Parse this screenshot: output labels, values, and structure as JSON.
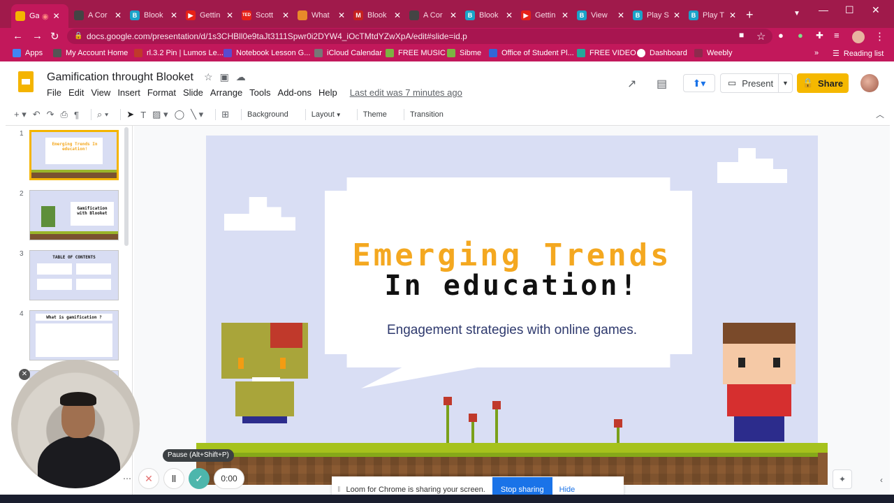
{
  "browser": {
    "tabs": [
      {
        "title": "Ga",
        "color": "#f4b400",
        "active": true
      },
      {
        "title": "A Cor",
        "color": "#444444"
      },
      {
        "title": "Blook",
        "color": "#1aa3c9"
      },
      {
        "title": "Gettin",
        "color": "#e62117"
      },
      {
        "title": "Scott",
        "color": "#e62117"
      },
      {
        "title": "What",
        "color": "#e88a2a"
      },
      {
        "title": "Blook",
        "color": "#c5221f"
      },
      {
        "title": "A Cor",
        "color": "#444444"
      },
      {
        "title": "Blook",
        "color": "#1aa3c9"
      },
      {
        "title": "Gettin",
        "color": "#e62117"
      },
      {
        "title": "View",
        "color": "#1aa3c9"
      },
      {
        "title": "Play S",
        "color": "#1aa3c9"
      },
      {
        "title": "Play T",
        "color": "#1aa3c9"
      }
    ],
    "url": "docs.google.com/presentation/d/1s3CHBll0e9taJt3111Spwr0i2DYW4_iOcTMtdYZwXpA/edit#slide=id.p",
    "bookmarks": [
      {
        "label": "Apps",
        "color": "#4285f4"
      },
      {
        "label": "My Account Home",
        "color": "#555555"
      },
      {
        "label": "rl.3.2 Pin | Lumos Le...",
        "color": "#c0392b"
      },
      {
        "label": "Notebook Lesson G...",
        "color": "#5b4bcf"
      },
      {
        "label": "iCloud Calendar",
        "color": "#777777"
      },
      {
        "label": "FREE MUSIC",
        "color": "#7cb342"
      },
      {
        "label": "Sibme",
        "color": "#7cb342"
      },
      {
        "label": "Office of Student Pl...",
        "color": "#3367d6"
      },
      {
        "label": "FREE VIDEO",
        "color": "#26a69a"
      },
      {
        "label": "Dashboard",
        "color": "#ffffff"
      },
      {
        "label": "Weebly",
        "color": "#8e2a4d"
      }
    ],
    "reading_list": "Reading list"
  },
  "slides": {
    "doc_title": "Gamification throught Blooket",
    "menu": [
      "File",
      "Edit",
      "View",
      "Insert",
      "Format",
      "Slide",
      "Arrange",
      "Tools",
      "Add-ons",
      "Help"
    ],
    "last_edit": "Last edit was 7 minutes ago",
    "present_label": "Present",
    "share_label": "Share",
    "toolbar_words": [
      "Background",
      "Layout",
      "Theme",
      "Transition"
    ],
    "thumbnails": [
      {
        "num": "1",
        "title": "Emerging Trends In education!"
      },
      {
        "num": "2",
        "title": "Gamification with Blooket"
      },
      {
        "num": "3",
        "title": "TABLE OF CONTENTS"
      },
      {
        "num": "4",
        "title": "What is gamification ?"
      }
    ]
  },
  "slide": {
    "title_line1": "Emerging Trends",
    "title_line2": "In education!",
    "subtitle": "Engagement strategies with online games.",
    "accent": "#f4a820",
    "background": "#d9def4"
  },
  "loom": {
    "tooltip": "Pause (Alt+Shift+P)",
    "timer": "0:00",
    "sharing_text": "Loom for Chrome is sharing your screen.",
    "stop_label": "Stop sharing",
    "hide_label": "Hide"
  }
}
